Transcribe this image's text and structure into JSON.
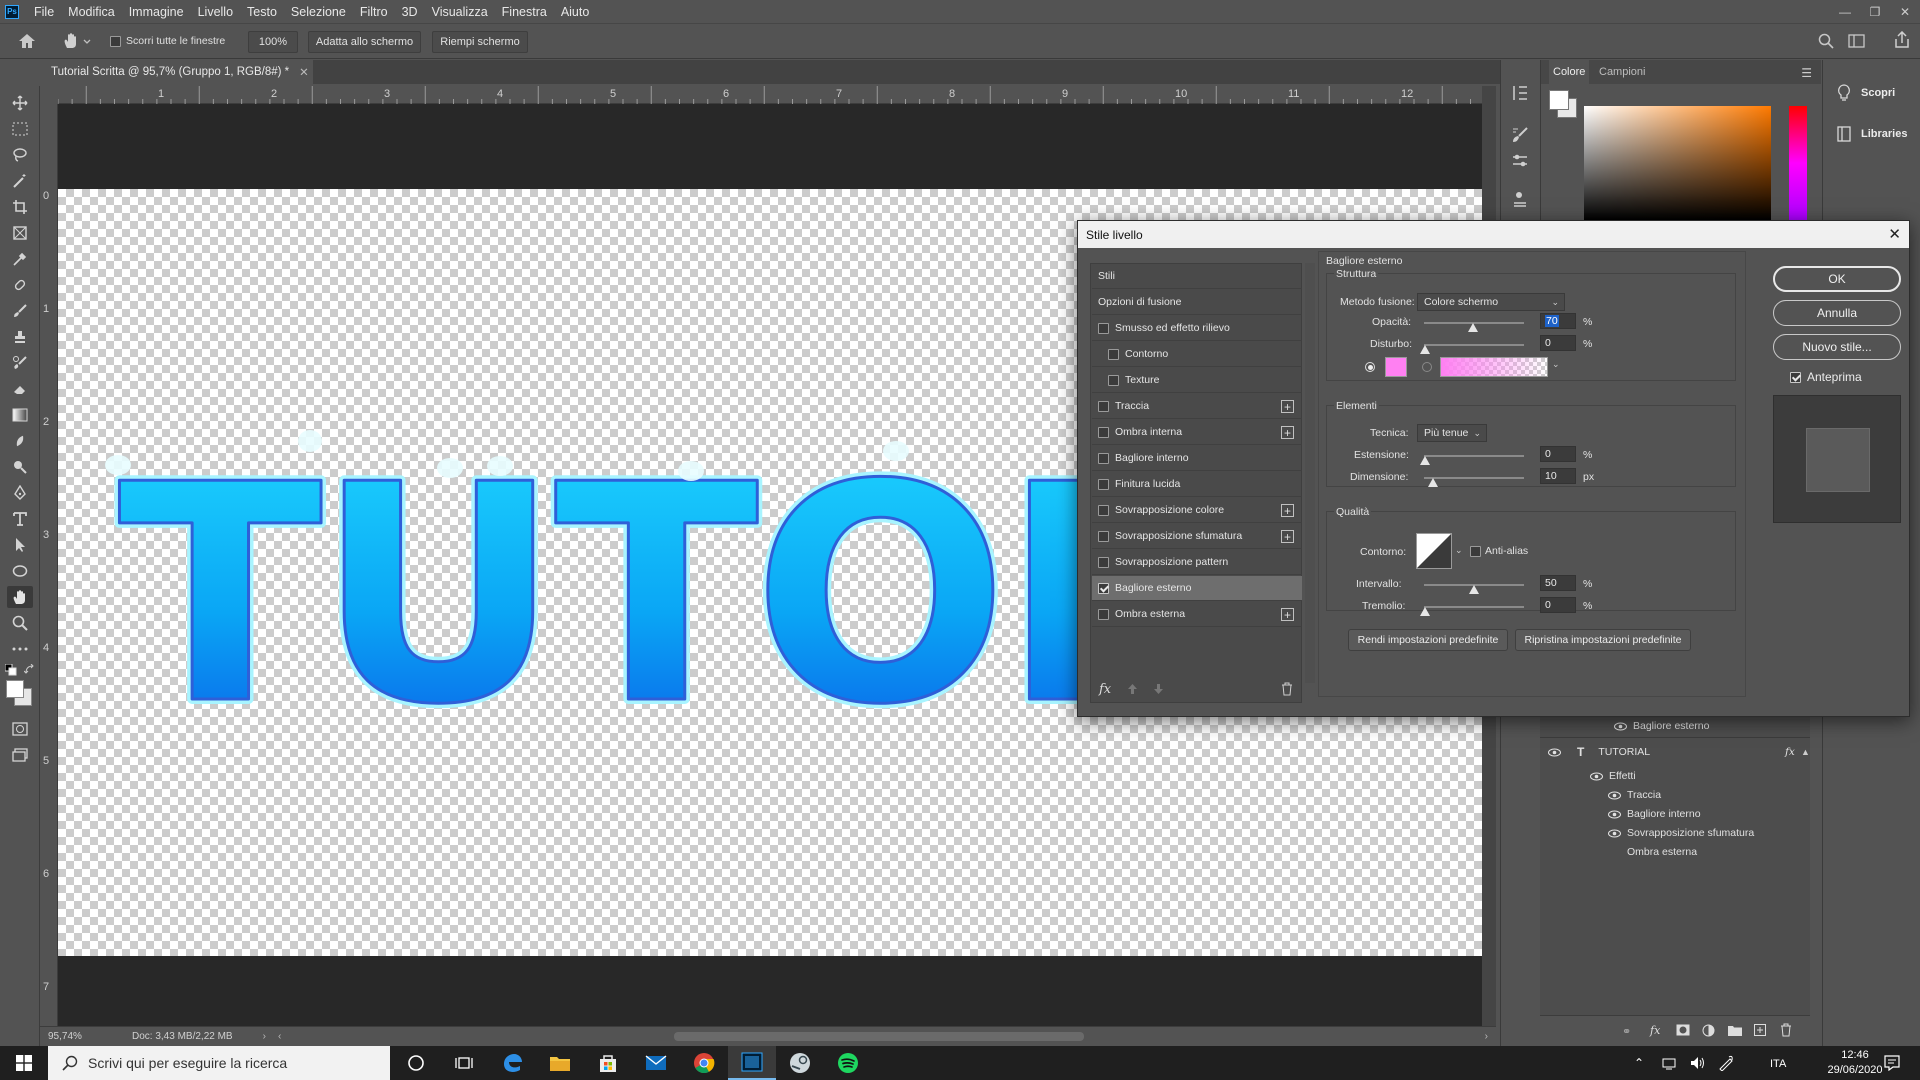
{
  "app": {
    "logo": "Ps",
    "menu": [
      "File",
      "Modifica",
      "Immagine",
      "Livello",
      "Testo",
      "Selezione",
      "Filtro",
      "3D",
      "Visualizza",
      "Finestra",
      "Aiuto"
    ]
  },
  "options": {
    "scroll_all_label": "Scorri tutte le finestre",
    "zoom_value": "100%",
    "fit_screen": "Adatta allo schermo",
    "fill_screen": "Riempi schermo"
  },
  "document": {
    "tab_title": "Tutorial Scritta @ 95,7% (Gruppo 1, RGB/8#) *",
    "artwork_text": "TUTORI",
    "ruler_h": [
      "1",
      "2",
      "3",
      "4",
      "5",
      "6",
      "7",
      "8",
      "9",
      "10",
      "11",
      "12"
    ],
    "ruler_v": [
      "0",
      "1",
      "2",
      "3",
      "4",
      "5",
      "6",
      "7"
    ]
  },
  "status": {
    "zoom": "95,74%",
    "doc_size": "Doc: 3,43 MB/2,22 MB"
  },
  "panels": {
    "color_tab": "Colore",
    "swatches_tab": "Campioni",
    "discover": "Scopri",
    "libraries": "Libraries"
  },
  "layers": {
    "row_outer_glow_top": "Bagliore esterno",
    "layer_name": "TUTORIAL",
    "effects_label": "Effetti",
    "effects": [
      "Traccia",
      "Bagliore interno",
      "Sovrapposizione sfumatura"
    ],
    "hidden_effect": "Ombra esterna"
  },
  "dialog": {
    "title": "Stile livello",
    "styles_header": "Stili",
    "blending_options": "Opzioni di fusione",
    "items": [
      {
        "label": "Smusso ed effetto rilievo",
        "checked": false,
        "indent": false,
        "plus": false
      },
      {
        "label": "Contorno",
        "checked": false,
        "indent": true,
        "plus": false
      },
      {
        "label": "Texture",
        "checked": false,
        "indent": true,
        "plus": false
      },
      {
        "label": "Traccia",
        "checked": false,
        "indent": false,
        "plus": true
      },
      {
        "label": "Ombra interna",
        "checked": false,
        "indent": false,
        "plus": true
      },
      {
        "label": "Bagliore interno",
        "checked": false,
        "indent": false,
        "plus": false
      },
      {
        "label": "Finitura lucida",
        "checked": false,
        "indent": false,
        "plus": false
      },
      {
        "label": "Sovrapposizione colore",
        "checked": false,
        "indent": false,
        "plus": true
      },
      {
        "label": "Sovrapposizione sfumatura",
        "checked": false,
        "indent": false,
        "plus": true
      },
      {
        "label": "Sovrapposizione pattern",
        "checked": false,
        "indent": false,
        "plus": false
      },
      {
        "label": "Bagliore esterno",
        "checked": true,
        "indent": false,
        "plus": false,
        "selected": true
      },
      {
        "label": "Ombra esterna",
        "checked": false,
        "indent": false,
        "plus": true
      }
    ],
    "fx_label": "fx",
    "section_title": "Bagliore esterno",
    "structure": {
      "legend": "Struttura",
      "blend_mode_label": "Metodo fusione:",
      "blend_mode": "Colore schermo",
      "opacity_label": "Opacità:",
      "opacity": "70",
      "noise_label": "Disturbo:",
      "noise": "0",
      "unit_pct": "%",
      "glow_color": "#ff80f2"
    },
    "elements": {
      "legend": "Elementi",
      "technique_label": "Tecnica:",
      "technique": "Più tenue",
      "spread_label": "Estensione:",
      "spread": "0",
      "size_label": "Dimensione:",
      "size": "10",
      "unit_px": "px"
    },
    "quality": {
      "legend": "Qualità",
      "contour_label": "Contorno:",
      "antialias_label": "Anti-alias",
      "range_label": "Intervallo:",
      "range": "50",
      "jitter_label": "Tremolio:",
      "jitter": "0"
    },
    "make_default": "Rendi impostazioni predefinite",
    "reset_default": "Ripristina impostazioni predefinite",
    "ok": "OK",
    "cancel": "Annulla",
    "new_style": "Nuovo stile...",
    "preview_label": "Anteprima"
  },
  "taskbar": {
    "search_placeholder": "Scrivi qui per eseguire la ricerca",
    "lang": "ITA",
    "time": "12:46",
    "date": "29/06/2020"
  },
  "colors": {
    "accent_blue": "#1b8cf0",
    "ps_blue": "#31a8ff"
  }
}
